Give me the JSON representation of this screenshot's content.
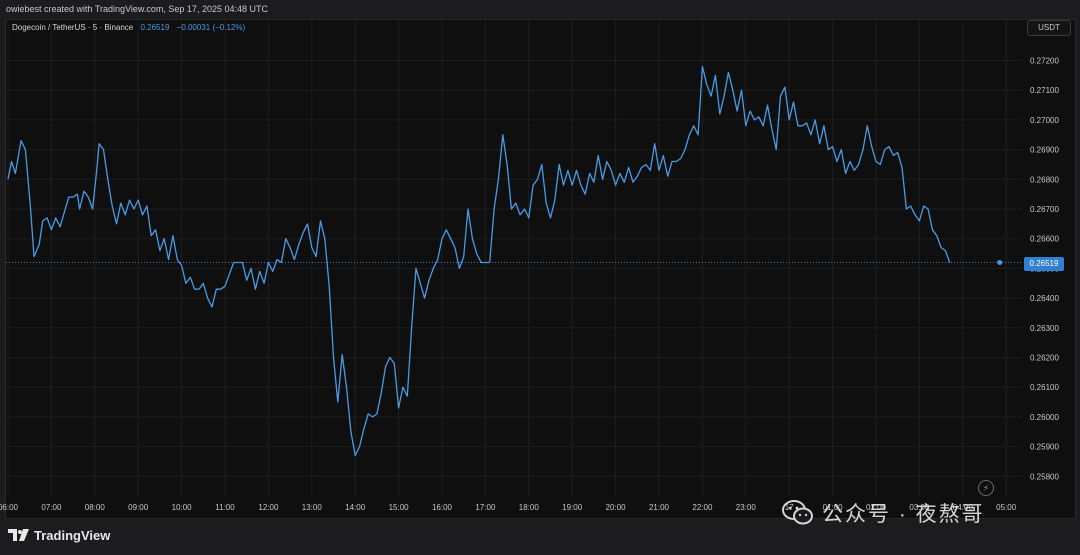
{
  "header": {
    "created_text": "owiebest created with TradingView.com, Sep 17, 2025 04:48 UTC"
  },
  "legend": {
    "symbol": "Dogecoin / TetherUS · 5 · Binance",
    "last_price": "0.26519",
    "change": "−0.00031 (−0.12%)"
  },
  "price_axis": {
    "currency": "USDT",
    "current_label": "0.26519"
  },
  "footer": {
    "brand": "TradingView"
  },
  "watermark": {
    "text": "公众号 · 夜熬哥"
  },
  "colors": {
    "line": "#4a9be6",
    "background": "#0f0f0f",
    "grid": "#1e1e1e",
    "price_label_bg": "#2f7fd3"
  },
  "chart_data": {
    "type": "line",
    "title": "Dogecoin / TetherUS · 5 · Binance",
    "ylabel": "USDT",
    "ylim": [
      0.2575,
      0.2725
    ],
    "yticks": [
      "0.27200",
      "0.27100",
      "0.27000",
      "0.26900",
      "0.26800",
      "0.26700",
      "0.26600",
      "0.26500",
      "0.26400",
      "0.26300",
      "0.26200",
      "0.26100",
      "0.26000",
      "0.25900",
      "0.25800"
    ],
    "xticks": [
      "06:00",
      "07:00",
      "08:00",
      "09:00",
      "10:00",
      "11:00",
      "12:00",
      "13:00",
      "14:00",
      "15:00",
      "16:00",
      "17:00",
      "18:00",
      "19:00",
      "20:00",
      "21:00",
      "22:00",
      "23:00",
      "17",
      "01:00",
      "02:00",
      "03:00",
      "04:00",
      "05:00"
    ],
    "x_hours": [
      0,
      0.08,
      0.17,
      0.3,
      0.4,
      0.52,
      0.6,
      0.72,
      0.8,
      0.9,
      1.0,
      1.1,
      1.2,
      1.3,
      1.4,
      1.5,
      1.6,
      1.65,
      1.75,
      1.85,
      1.95,
      2.05,
      2.1,
      2.2,
      2.3,
      2.4,
      2.5,
      2.6,
      2.7,
      2.8,
      2.9,
      3.0,
      3.1,
      3.2,
      3.3,
      3.4,
      3.5,
      3.6,
      3.7,
      3.8,
      3.9,
      4.0,
      4.1,
      4.2,
      4.3,
      4.4,
      4.5,
      4.6,
      4.7,
      4.8,
      4.9,
      5.0,
      5.1,
      5.2,
      5.3,
      5.4,
      5.5,
      5.6,
      5.7,
      5.8,
      5.9,
      6.0,
      6.1,
      6.2,
      6.3,
      6.4,
      6.5,
      6.6,
      6.7,
      6.8,
      6.9,
      7.0,
      7.1,
      7.2,
      7.3,
      7.4,
      7.5,
      7.6,
      7.7,
      7.8,
      7.9,
      8.0,
      8.1,
      8.2,
      8.3,
      8.4,
      8.5,
      8.6,
      8.7,
      8.8,
      8.9,
      9.0,
      9.1,
      9.2,
      9.3,
      9.4,
      9.5,
      9.6,
      9.7,
      9.8,
      9.9,
      10.0,
      10.1,
      10.2,
      10.3,
      10.4,
      10.5,
      10.6,
      10.7,
      10.8,
      10.9,
      11.0,
      11.1,
      11.2,
      11.3,
      11.4,
      11.5,
      11.6,
      11.7,
      11.8,
      11.9,
      12.0,
      12.1,
      12.2,
      12.3,
      12.4,
      12.5,
      12.6,
      12.7,
      12.8,
      12.9,
      13.0,
      13.1,
      13.2,
      13.3,
      13.4,
      13.5,
      13.6,
      13.7,
      13.8,
      13.9,
      14.0,
      14.1,
      14.2,
      14.3,
      14.4,
      14.5,
      14.6,
      14.7,
      14.8,
      14.9,
      15.0,
      15.1,
      15.2,
      15.3,
      15.4,
      15.5,
      15.6,
      15.7,
      15.8,
      15.9,
      16.0,
      16.1,
      16.2,
      16.3,
      16.4,
      16.5,
      16.6,
      16.7,
      16.8,
      16.9,
      17.0,
      17.1,
      17.2,
      17.3,
      17.4,
      17.5,
      17.6,
      17.7,
      17.8,
      17.9,
      18.0,
      18.1,
      18.2,
      18.3,
      18.4,
      18.5,
      18.6,
      18.7,
      18.8,
      18.9,
      19.0,
      19.1,
      19.2,
      19.3,
      19.4,
      19.5,
      19.6,
      19.7,
      19.8,
      19.9,
      20.0,
      20.1,
      20.2,
      20.3,
      20.4,
      20.5,
      20.6,
      20.7,
      20.8,
      20.9,
      21.0,
      21.1,
      21.2,
      21.3,
      21.4,
      21.5,
      21.6,
      21.7,
      21.8,
      21.9,
      22.0,
      22.1,
      22.2,
      22.3,
      22.4,
      22.5,
      22.6,
      22.75,
      22.85
    ],
    "values": [
      0.268,
      0.2686,
      0.2682,
      0.2693,
      0.269,
      0.267,
      0.2654,
      0.2658,
      0.2666,
      0.2667,
      0.2663,
      0.2667,
      0.2664,
      0.2669,
      0.2674,
      0.2674,
      0.2675,
      0.267,
      0.2676,
      0.2674,
      0.267,
      0.2684,
      0.2692,
      0.269,
      0.268,
      0.2671,
      0.2665,
      0.2672,
      0.2668,
      0.2673,
      0.267,
      0.2673,
      0.2668,
      0.2671,
      0.2661,
      0.2663,
      0.2656,
      0.266,
      0.2653,
      0.2661,
      0.2653,
      0.2651,
      0.2645,
      0.2647,
      0.2643,
      0.2643,
      0.2645,
      0.264,
      0.2637,
      0.2643,
      0.2643,
      0.2644,
      0.2648,
      0.2652,
      0.2652,
      0.2652,
      0.2646,
      0.265,
      0.2643,
      0.2649,
      0.2645,
      0.2652,
      0.2649,
      0.2653,
      0.2652,
      0.266,
      0.2657,
      0.2653,
      0.2658,
      0.2662,
      0.2665,
      0.2657,
      0.2654,
      0.2666,
      0.266,
      0.2644,
      0.262,
      0.2605,
      0.2621,
      0.261,
      0.2595,
      0.2587,
      0.259,
      0.2596,
      0.2601,
      0.26,
      0.2601,
      0.2608,
      0.2617,
      0.262,
      0.2618,
      0.2603,
      0.261,
      0.2607,
      0.263,
      0.265,
      0.2645,
      0.264,
      0.2646,
      0.265,
      0.2653,
      0.266,
      0.2663,
      0.266,
      0.2657,
      0.265,
      0.2654,
      0.267,
      0.266,
      0.2655,
      0.2652,
      0.2652,
      0.2652,
      0.267,
      0.268,
      0.2695,
      0.2685,
      0.267,
      0.2672,
      0.2668,
      0.267,
      0.2667,
      0.2678,
      0.268,
      0.2685,
      0.2672,
      0.2667,
      0.2673,
      0.2685,
      0.2678,
      0.2683,
      0.2678,
      0.2683,
      0.2678,
      0.2675,
      0.2682,
      0.2679,
      0.2688,
      0.268,
      0.2686,
      0.2683,
      0.2678,
      0.2682,
      0.2679,
      0.2684,
      0.2679,
      0.2681,
      0.2684,
      0.2685,
      0.2683,
      0.2692,
      0.2683,
      0.2688,
      0.2681,
      0.2686,
      0.2686,
      0.2687,
      0.269,
      0.2695,
      0.2698,
      0.2695,
      0.2718,
      0.2712,
      0.2708,
      0.2715,
      0.2702,
      0.2708,
      0.2716,
      0.271,
      0.2703,
      0.271,
      0.2698,
      0.2703,
      0.27,
      0.2701,
      0.2698,
      0.2705,
      0.2697,
      0.269,
      0.2708,
      0.2711,
      0.27,
      0.2706,
      0.2698,
      0.2698,
      0.2699,
      0.2695,
      0.27,
      0.2692,
      0.2698,
      0.269,
      0.2691,
      0.2686,
      0.269,
      0.2682,
      0.2686,
      0.2683,
      0.2685,
      0.269,
      0.2698,
      0.2691,
      0.2686,
      0.2685,
      0.269,
      0.2691,
      0.2688,
      0.2689,
      0.2684,
      0.267,
      0.2671,
      0.2668,
      0.2666,
      0.2671,
      0.267,
      0.2663,
      0.2661,
      0.2657,
      0.2656,
      0.2652
    ]
  }
}
